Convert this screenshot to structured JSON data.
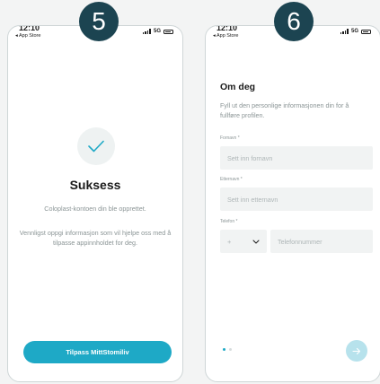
{
  "steps": [
    "5",
    "6"
  ],
  "status_bar": {
    "time": "12:10",
    "back_label": "◂ App Store",
    "network": "5G"
  },
  "screen5": {
    "title": "Suksess",
    "text1": "Coloplast-kontoen din ble opprettet.",
    "text2": "Vennligst oppgi informasjon som vil hjelpe oss med å tilpasse appinnholdet for deg.",
    "button_label": "Tilpass MittStomiliv"
  },
  "screen6": {
    "title": "Om deg",
    "subtitle": "Fyll ut den personlige informasjonen din for å fullføre profilen.",
    "firstname_label": "Fornavn *",
    "firstname_placeholder": "Sett inn fornavn",
    "lastname_label": "Etternavn *",
    "lastname_placeholder": "Sett inn etternavn",
    "phone_label": "Telefon *",
    "country_code": "+",
    "phone_placeholder": "Telefonnummer",
    "page_index": 1,
    "page_count": 2
  },
  "colors": {
    "accent": "#1ea9c6",
    "badge": "#1c4451",
    "next_disabled": "#b7e2ec",
    "muted_text": "#8b9596"
  },
  "icons": {
    "check": "checkmark-icon",
    "next": "arrow-right-icon",
    "dropdown": "chevron-down-icon"
  }
}
